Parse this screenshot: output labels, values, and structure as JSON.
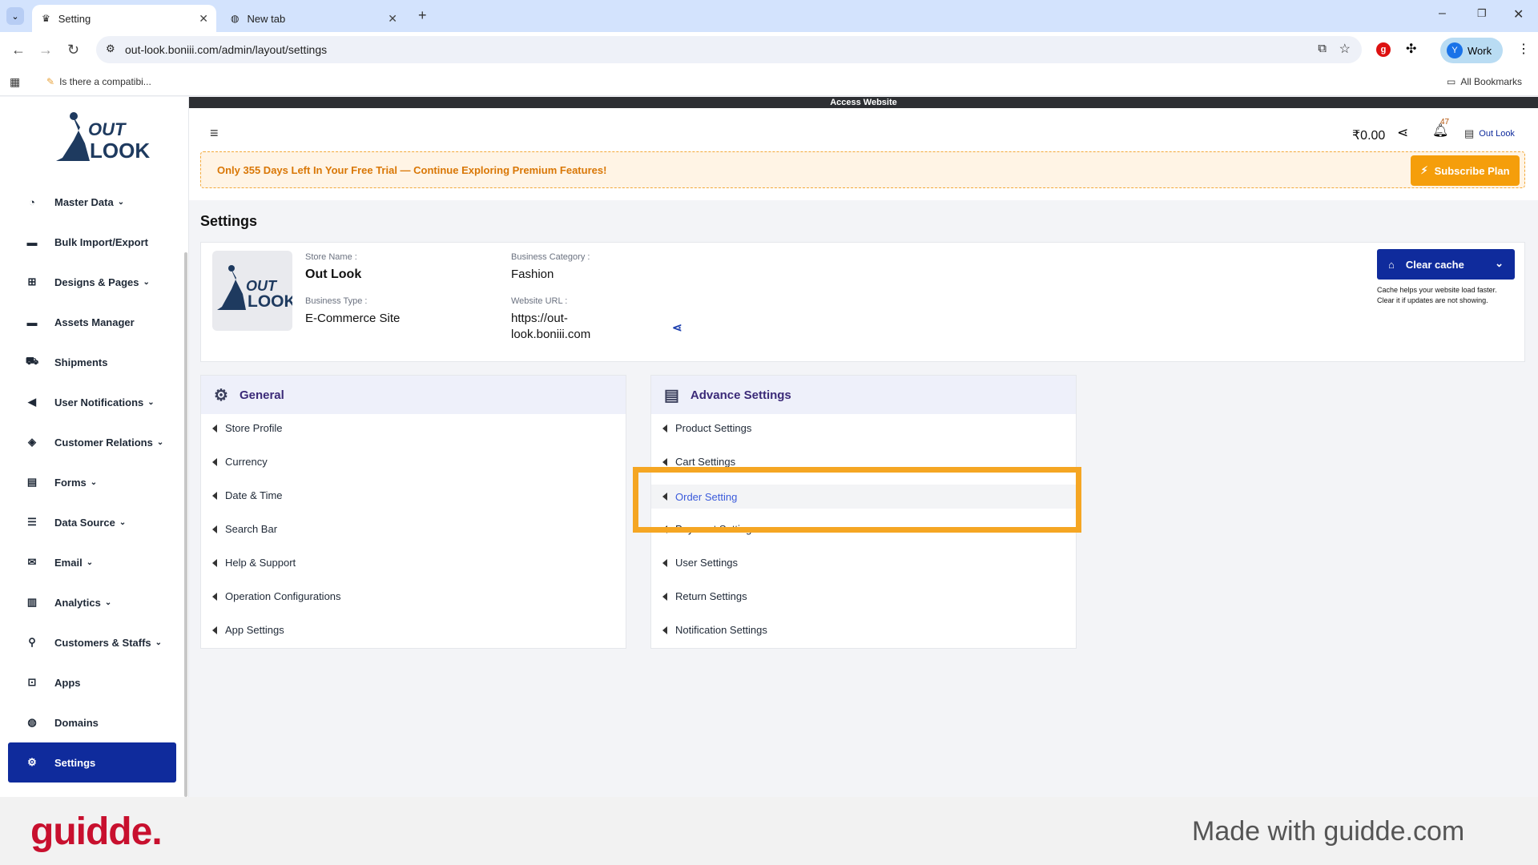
{
  "browser": {
    "tabs": [
      {
        "label": "Setting",
        "active": true
      },
      {
        "label": "New tab",
        "active": false
      }
    ],
    "url": "out-look.boniii.com/admin/layout/settings",
    "bookmark": "Is there a compatibi...",
    "all_bookmarks": "All Bookmarks",
    "profile_initial": "Y",
    "profile_label": "Work"
  },
  "logo": {
    "line1": "OUT",
    "line2": "LOOK"
  },
  "sidebar": {
    "items": [
      {
        "label": "Master Data",
        "chevron": "⌄",
        "icon": "dashboard-icon"
      },
      {
        "label": "Bulk Import/Export",
        "chevron": "",
        "icon": "folder-icon"
      },
      {
        "label": "Designs & Pages",
        "chevron": "⌄",
        "icon": "design-icon"
      },
      {
        "label": "Assets Manager",
        "chevron": "",
        "icon": "folder-icon"
      },
      {
        "label": "Shipments",
        "chevron": "",
        "icon": "truck-icon"
      },
      {
        "label": "User Notifications",
        "chevron": "⌄",
        "icon": "megaphone-icon"
      },
      {
        "label": "Customer Relations",
        "chevron": "⌄",
        "icon": "handshake-icon"
      },
      {
        "label": "Forms",
        "chevron": "⌄",
        "icon": "form-icon"
      },
      {
        "label": "Data Source",
        "chevron": "⌄",
        "icon": "database-icon"
      },
      {
        "label": "Email",
        "chevron": "⌄",
        "icon": "mail-icon"
      },
      {
        "label": "Analytics",
        "chevron": "⌄",
        "icon": "chart-icon"
      },
      {
        "label": "Customers & Staffs",
        "chevron": "⌄",
        "icon": "users-icon"
      },
      {
        "label": "Apps",
        "chevron": "",
        "icon": "apps-icon"
      },
      {
        "label": "Domains",
        "chevron": "",
        "icon": "globe-icon"
      },
      {
        "label": "Settings",
        "chevron": "",
        "icon": "gear-icon",
        "active": true
      }
    ]
  },
  "access_bar": "Access Website",
  "header": {
    "balance": "₹0.00",
    "notification_count": "47",
    "store_link": "Out Look",
    "trial_message": "Only 355 Days Left In Your Free Trial — Continue Exploring Premium Features!",
    "subscribe_label": "Subscribe Plan"
  },
  "page_title": "Settings",
  "store": {
    "name_label": "Store Name :",
    "name": "Out Look",
    "type_label": "Business Type :",
    "type": "E-Commerce Site",
    "category_label": "Business Category :",
    "category": "Fashion",
    "url_label": "Website URL :",
    "url_line1": "https://out-",
    "url_line2": "look.boniii.com"
  },
  "cache": {
    "button_label": "Clear cache",
    "help_line1": "Cache helps your website load faster.",
    "help_line2": "Clear it if updates are not showing."
  },
  "general": {
    "title": "General",
    "items": [
      "Store Profile",
      "Currency",
      "Date & Time",
      "Search Bar",
      "Help & Support",
      "Operation Configurations",
      "App Settings"
    ]
  },
  "advance": {
    "title": "Advance Settings",
    "items": [
      "Product Settings",
      "Cart Settings",
      "Order Setting",
      "Payment Settings",
      "User Settings",
      "Return Settings",
      "Notification Settings"
    ],
    "highlighted_index": 2
  },
  "colors": {
    "accent": "#0f2b9c",
    "highlight": "#f5a623",
    "subscribe": "#f59e0b"
  },
  "footer": {
    "brand": "guidde.",
    "made_with": "Made with guidde.com"
  }
}
